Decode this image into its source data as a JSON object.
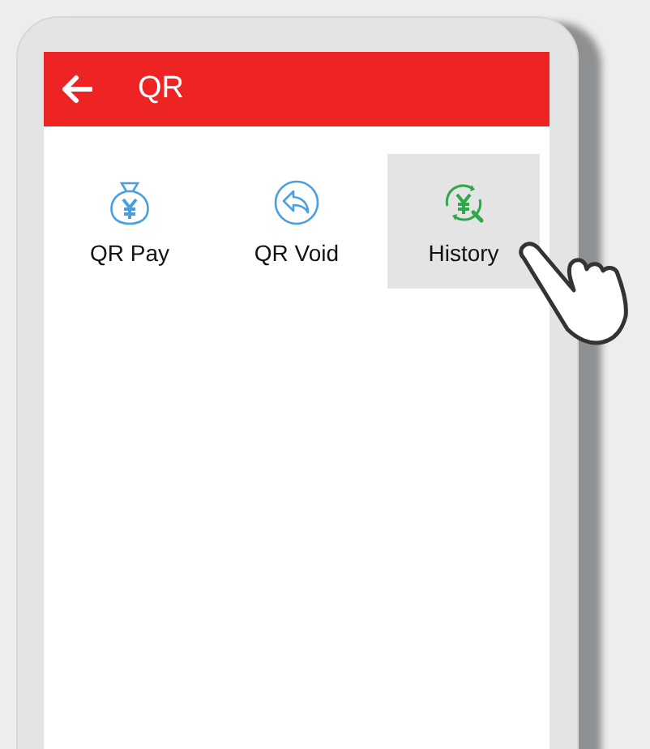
{
  "header": {
    "title": "QR"
  },
  "items": [
    {
      "label": "QR Pay",
      "kind": "pay",
      "selected": false
    },
    {
      "label": "QR Void",
      "kind": "void",
      "selected": false
    },
    {
      "label": "History",
      "kind": "history",
      "selected": true
    }
  ]
}
